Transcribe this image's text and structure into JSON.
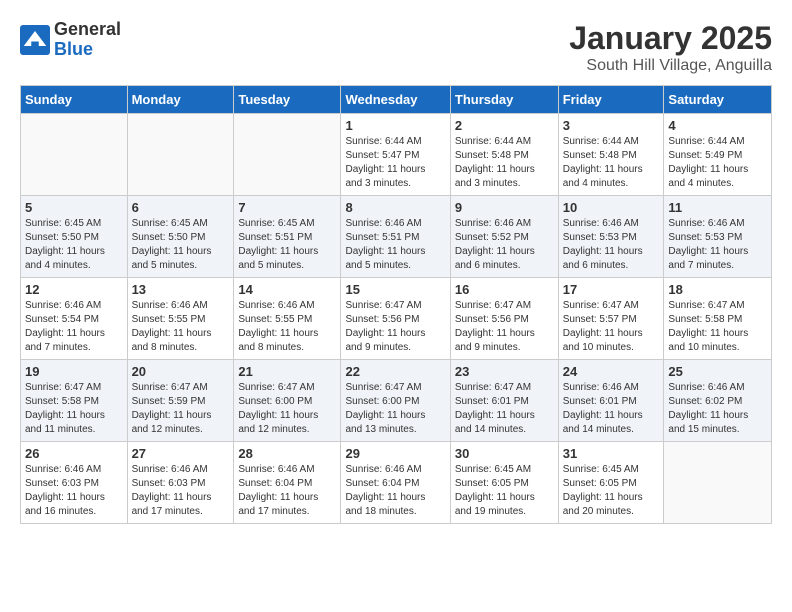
{
  "header": {
    "logo_general": "General",
    "logo_blue": "Blue",
    "title": "January 2025",
    "subtitle": "South Hill Village, Anguilla"
  },
  "weekdays": [
    "Sunday",
    "Monday",
    "Tuesday",
    "Wednesday",
    "Thursday",
    "Friday",
    "Saturday"
  ],
  "weeks": [
    [
      {
        "day": "",
        "content": ""
      },
      {
        "day": "",
        "content": ""
      },
      {
        "day": "",
        "content": ""
      },
      {
        "day": "1",
        "content": "Sunrise: 6:44 AM\nSunset: 5:47 PM\nDaylight: 11 hours\nand 3 minutes."
      },
      {
        "day": "2",
        "content": "Sunrise: 6:44 AM\nSunset: 5:48 PM\nDaylight: 11 hours\nand 3 minutes."
      },
      {
        "day": "3",
        "content": "Sunrise: 6:44 AM\nSunset: 5:48 PM\nDaylight: 11 hours\nand 4 minutes."
      },
      {
        "day": "4",
        "content": "Sunrise: 6:44 AM\nSunset: 5:49 PM\nDaylight: 11 hours\nand 4 minutes."
      }
    ],
    [
      {
        "day": "5",
        "content": "Sunrise: 6:45 AM\nSunset: 5:50 PM\nDaylight: 11 hours\nand 4 minutes."
      },
      {
        "day": "6",
        "content": "Sunrise: 6:45 AM\nSunset: 5:50 PM\nDaylight: 11 hours\nand 5 minutes."
      },
      {
        "day": "7",
        "content": "Sunrise: 6:45 AM\nSunset: 5:51 PM\nDaylight: 11 hours\nand 5 minutes."
      },
      {
        "day": "8",
        "content": "Sunrise: 6:46 AM\nSunset: 5:51 PM\nDaylight: 11 hours\nand 5 minutes."
      },
      {
        "day": "9",
        "content": "Sunrise: 6:46 AM\nSunset: 5:52 PM\nDaylight: 11 hours\nand 6 minutes."
      },
      {
        "day": "10",
        "content": "Sunrise: 6:46 AM\nSunset: 5:53 PM\nDaylight: 11 hours\nand 6 minutes."
      },
      {
        "day": "11",
        "content": "Sunrise: 6:46 AM\nSunset: 5:53 PM\nDaylight: 11 hours\nand 7 minutes."
      }
    ],
    [
      {
        "day": "12",
        "content": "Sunrise: 6:46 AM\nSunset: 5:54 PM\nDaylight: 11 hours\nand 7 minutes."
      },
      {
        "day": "13",
        "content": "Sunrise: 6:46 AM\nSunset: 5:55 PM\nDaylight: 11 hours\nand 8 minutes."
      },
      {
        "day": "14",
        "content": "Sunrise: 6:46 AM\nSunset: 5:55 PM\nDaylight: 11 hours\nand 8 minutes."
      },
      {
        "day": "15",
        "content": "Sunrise: 6:47 AM\nSunset: 5:56 PM\nDaylight: 11 hours\nand 9 minutes."
      },
      {
        "day": "16",
        "content": "Sunrise: 6:47 AM\nSunset: 5:56 PM\nDaylight: 11 hours\nand 9 minutes."
      },
      {
        "day": "17",
        "content": "Sunrise: 6:47 AM\nSunset: 5:57 PM\nDaylight: 11 hours\nand 10 minutes."
      },
      {
        "day": "18",
        "content": "Sunrise: 6:47 AM\nSunset: 5:58 PM\nDaylight: 11 hours\nand 10 minutes."
      }
    ],
    [
      {
        "day": "19",
        "content": "Sunrise: 6:47 AM\nSunset: 5:58 PM\nDaylight: 11 hours\nand 11 minutes."
      },
      {
        "day": "20",
        "content": "Sunrise: 6:47 AM\nSunset: 5:59 PM\nDaylight: 11 hours\nand 12 minutes."
      },
      {
        "day": "21",
        "content": "Sunrise: 6:47 AM\nSunset: 6:00 PM\nDaylight: 11 hours\nand 12 minutes."
      },
      {
        "day": "22",
        "content": "Sunrise: 6:47 AM\nSunset: 6:00 PM\nDaylight: 11 hours\nand 13 minutes."
      },
      {
        "day": "23",
        "content": "Sunrise: 6:47 AM\nSunset: 6:01 PM\nDaylight: 11 hours\nand 14 minutes."
      },
      {
        "day": "24",
        "content": "Sunrise: 6:46 AM\nSunset: 6:01 PM\nDaylight: 11 hours\nand 14 minutes."
      },
      {
        "day": "25",
        "content": "Sunrise: 6:46 AM\nSunset: 6:02 PM\nDaylight: 11 hours\nand 15 minutes."
      }
    ],
    [
      {
        "day": "26",
        "content": "Sunrise: 6:46 AM\nSunset: 6:03 PM\nDaylight: 11 hours\nand 16 minutes."
      },
      {
        "day": "27",
        "content": "Sunrise: 6:46 AM\nSunset: 6:03 PM\nDaylight: 11 hours\nand 17 minutes."
      },
      {
        "day": "28",
        "content": "Sunrise: 6:46 AM\nSunset: 6:04 PM\nDaylight: 11 hours\nand 17 minutes."
      },
      {
        "day": "29",
        "content": "Sunrise: 6:46 AM\nSunset: 6:04 PM\nDaylight: 11 hours\nand 18 minutes."
      },
      {
        "day": "30",
        "content": "Sunrise: 6:45 AM\nSunset: 6:05 PM\nDaylight: 11 hours\nand 19 minutes."
      },
      {
        "day": "31",
        "content": "Sunrise: 6:45 AM\nSunset: 6:05 PM\nDaylight: 11 hours\nand 20 minutes."
      },
      {
        "day": "",
        "content": ""
      }
    ]
  ]
}
